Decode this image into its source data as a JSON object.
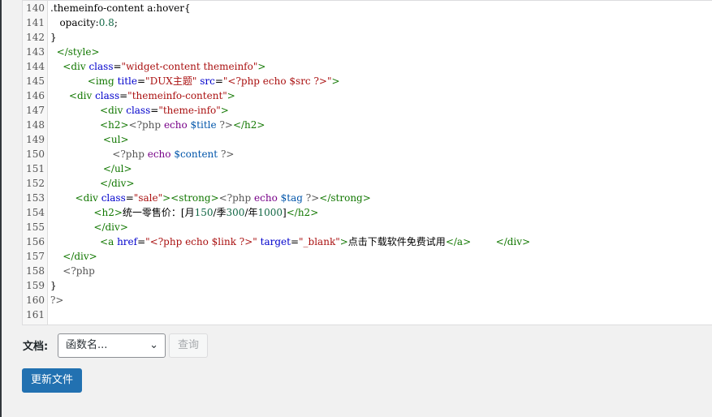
{
  "editor": {
    "lines": [
      {
        "n": "140",
        "code": ".themeinfo-content a:hover{"
      },
      {
        "n": "141",
        "code": "   opacity:0.8;"
      },
      {
        "n": "142",
        "code": "}"
      },
      {
        "n": "143",
        "code": "  </style>"
      },
      {
        "n": "144",
        "code": "    <div class=\"widget-content themeinfo\">"
      },
      {
        "n": "145",
        "code": "            <img title=\"DUX主题\" src=\"<?php echo $src ?>\">"
      },
      {
        "n": "146",
        "code": "      <div class=\"themeinfo-content\">"
      },
      {
        "n": "147",
        "code": "                <div class=\"theme-info\">"
      },
      {
        "n": "148",
        "code": "                <h2><?php echo $title ?></h2>"
      },
      {
        "n": "149",
        "code": "                 <ul>"
      },
      {
        "n": "150",
        "code": "                    <?php echo $content ?>"
      },
      {
        "n": "151",
        "code": "                 </ul>"
      },
      {
        "n": "152",
        "code": "                </div>"
      },
      {
        "n": "153",
        "code": "        <div class=\"sale\"><strong><?php echo $tag ?></strong>"
      },
      {
        "n": "154",
        "code": "              <h2>统一零售价：[月150/季300/年1000]</h2>"
      },
      {
        "n": "155",
        "code": "              </div>"
      },
      {
        "n": "156",
        "code": "                <a href=\"<?php echo $link ?>\" target=\"_blank\">点击下载软件免费试用</a>        </div>"
      },
      {
        "n": "157",
        "code": "    </div>"
      },
      {
        "n": "158",
        "code": "    <?php"
      },
      {
        "n": "159",
        "code": "}"
      },
      {
        "n": "160",
        "code": "?>"
      },
      {
        "n": "161",
        "code": ""
      }
    ]
  },
  "doc": {
    "label": "文档:",
    "select_value": "函数名...",
    "lookup_label": "查询"
  },
  "update_label": "更新文件",
  "icons": {
    "select_chevron": "chevron-down-icon"
  }
}
